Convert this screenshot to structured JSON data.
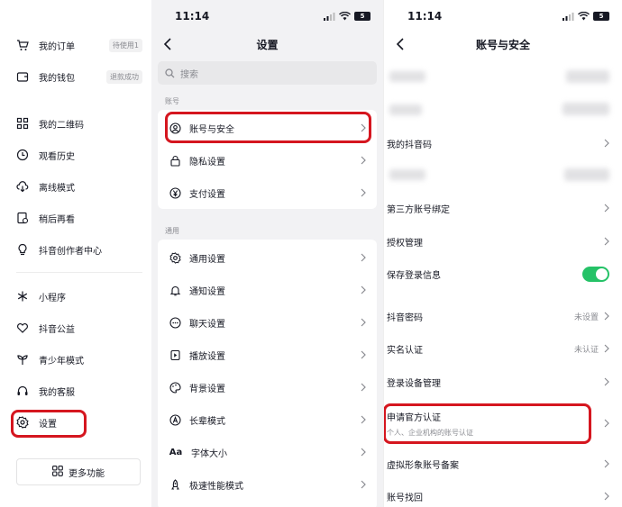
{
  "left_menu": {
    "items": [
      {
        "label": "我的订单",
        "icon": "cart-icon",
        "badge": "待使用1"
      },
      {
        "label": "我的钱包",
        "icon": "wallet-icon",
        "badge": "退款成功"
      },
      {
        "label": "我的二维码",
        "icon": "qr-icon"
      },
      {
        "label": "观看历史",
        "icon": "clock-icon"
      },
      {
        "label": "离线模式",
        "icon": "cloud-download-icon"
      },
      {
        "label": "稍后再看",
        "icon": "bookmark-later-icon"
      },
      {
        "label": "抖音创作者中心",
        "icon": "lightbulb-icon"
      },
      {
        "label": "小程序",
        "icon": "asterisk-icon"
      },
      {
        "label": "抖音公益",
        "icon": "heart-hands-icon"
      },
      {
        "label": "青少年模式",
        "icon": "sprout-icon"
      },
      {
        "label": "我的客服",
        "icon": "headset-icon"
      },
      {
        "label": "设置",
        "icon": "gear-icon"
      }
    ],
    "more_button": "更多功能"
  },
  "status_bar": {
    "time": "11:14",
    "battery": "5"
  },
  "settings": {
    "title": "设置",
    "search_placeholder": "搜索",
    "section_account": "账号",
    "account_rows": [
      {
        "label": "账号与安全",
        "icon": "account-shield-icon"
      },
      {
        "label": "隐私设置",
        "icon": "lock-icon"
      },
      {
        "label": "支付设置",
        "icon": "yen-icon"
      }
    ],
    "section_general": "通用",
    "general_rows": [
      {
        "label": "通用设置",
        "icon": "gear-icon"
      },
      {
        "label": "通知设置",
        "icon": "bell-icon"
      },
      {
        "label": "聊天设置",
        "icon": "chat-icon"
      },
      {
        "label": "播放设置",
        "icon": "play-icon"
      },
      {
        "label": "背景设置",
        "icon": "palette-icon"
      },
      {
        "label": "长辈模式",
        "icon": "elder-icon"
      },
      {
        "label": "字体大小",
        "icon": "font-size-icon",
        "glyph": "Aa"
      },
      {
        "label": "极速性能模式",
        "icon": "rocket-icon"
      }
    ]
  },
  "account_security": {
    "title": "账号与安全",
    "rows": [
      {
        "label": "我的抖音码"
      },
      {
        "label": "第三方账号绑定"
      },
      {
        "label": "授权管理"
      },
      {
        "label": "保存登录信息",
        "toggle": true
      },
      {
        "label": "抖音密码",
        "value": "未设置"
      },
      {
        "label": "实名认证",
        "value": "未认证"
      },
      {
        "label": "登录设备管理"
      },
      {
        "label": "申请官方认证",
        "sub": "个人、企业机构的账号认证"
      },
      {
        "label": "虚拟形象账号备案"
      },
      {
        "label": "账号找回"
      }
    ]
  },
  "colors": {
    "highlight": "#d5161f",
    "toggle_on": "#25c267"
  }
}
